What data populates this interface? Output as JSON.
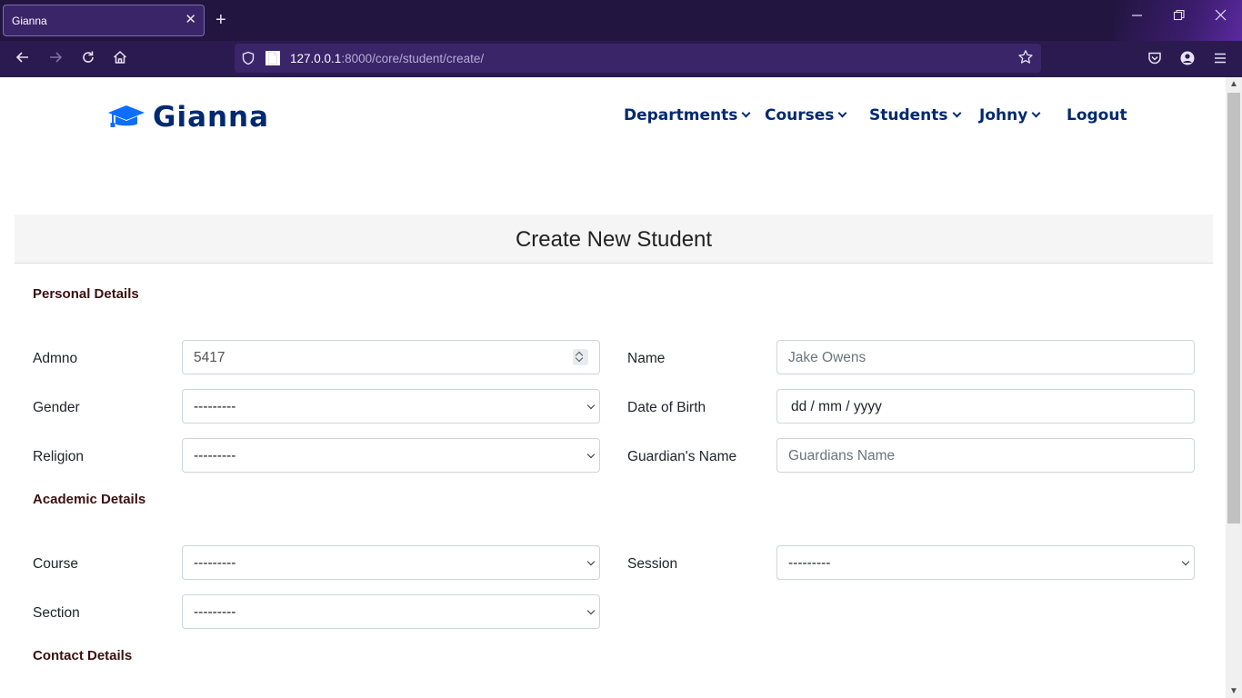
{
  "browser": {
    "tab_title": "Gianna",
    "tab_close": "✕",
    "new_tab": "+",
    "url_host": "127.0.0.1",
    "url_rest": ":8000/core/student/create/"
  },
  "site": {
    "brand": "Gianna",
    "nav": [
      {
        "label": "Departments"
      },
      {
        "label": "Courses"
      },
      {
        "label": "Students"
      },
      {
        "label": "Johny"
      },
      {
        "label": "Logout"
      }
    ]
  },
  "form": {
    "title": "Create New Student",
    "sections": {
      "personal": "Personal Details",
      "academic": "Academic Details",
      "contact": "Contact Details"
    },
    "labels": {
      "admno": "Admno",
      "name": "Name",
      "gender": "Gender",
      "dob": "Date of Birth",
      "religion": "Religion",
      "guardian": "Guardian's Name",
      "course": "Course",
      "session": "Session",
      "section": "Section"
    },
    "values": {
      "admno": "5417",
      "name_placeholder": "Jake Owens",
      "gender": "---------",
      "dob": "dd / mm / yyyy",
      "religion": "---------",
      "guardian_placeholder": "Guardians Name",
      "course": "---------",
      "session": "---------",
      "section": "---------"
    }
  },
  "colors": {
    "brand": "#012970",
    "section_heading": "#3b1010",
    "browser_chrome": "#2b1a4f"
  }
}
